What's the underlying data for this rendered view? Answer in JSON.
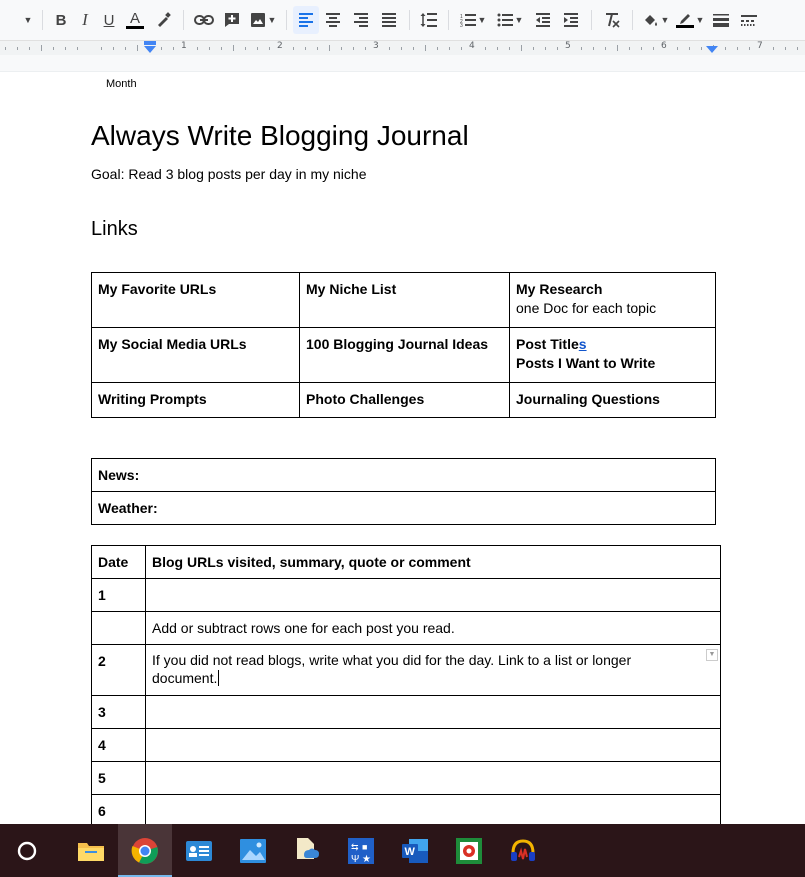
{
  "toolbar": {
    "buttons": [
      "more-caret",
      "bold",
      "italic",
      "underline",
      "text-color",
      "highlight",
      "link",
      "comment",
      "image",
      "align-left",
      "align-center",
      "align-right",
      "justify",
      "line-spacing",
      "numbered-list",
      "bulleted-list",
      "decrease-indent",
      "increase-indent",
      "clear-formatting",
      "fill-color",
      "border-color",
      "border-width",
      "border-dash"
    ],
    "glyphs": {
      "bold": "B",
      "italic": "I",
      "underline": "U",
      "text_color": "A"
    },
    "colors": {
      "active_bg": "#e8f0fe",
      "accent": "#1a73e8",
      "text_color_bar": "#000000"
    }
  },
  "ruler": {
    "numbers": [
      "1",
      "2",
      "3",
      "4",
      "5",
      "6",
      "7"
    ]
  },
  "document": {
    "header_month": "Month",
    "title": "Always Write Blogging Journal",
    "goal": "Goal: Read 3 blog posts per day in my niche",
    "links_heading": "Links",
    "links_table": [
      [
        {
          "lines": [
            "My Favorite URLs"
          ]
        },
        {
          "lines": [
            "My Niche List"
          ]
        },
        {
          "lines": [
            "My Research"
          ],
          "sub": "one Doc for each topic"
        }
      ],
      [
        {
          "lines": [
            "My Social Media URLs"
          ]
        },
        {
          "lines": [
            "100 Blogging Journal Ideas"
          ]
        },
        {
          "lines": [
            "Post Title",
            "Posts I Want to Write"
          ],
          "link_suffix": "s"
        }
      ],
      [
        {
          "lines": [
            "Writing Prompts"
          ]
        },
        {
          "lines": [
            "Photo Challenges"
          ]
        },
        {
          "lines": [
            "Journaling Questions"
          ]
        }
      ]
    ],
    "news_label": "News:",
    "weather_label": "Weather:",
    "log_table": {
      "headers": [
        "Date",
        "Blog URLs visited, summary, quote or comment"
      ],
      "rows": [
        {
          "date": "1",
          "text": ""
        },
        {
          "date": "",
          "text": "Add or subtract rows one for each post you read."
        },
        {
          "date": "2",
          "text": "If you did not read blogs, write what you did for the day. Link to a list or longer document."
        },
        {
          "date": "3",
          "text": ""
        },
        {
          "date": "4",
          "text": ""
        },
        {
          "date": "5",
          "text": ""
        },
        {
          "date": "6",
          "text": ""
        }
      ]
    }
  },
  "taskbar": {
    "items": [
      "start-circle",
      "file-explorer",
      "chrome",
      "contacts-card",
      "photos",
      "onedrive-file",
      "store-tools",
      "word",
      "green-app",
      "audio-app"
    ],
    "colors": {
      "bg": "#2b1518",
      "active_underline": "#76b9ed"
    }
  }
}
